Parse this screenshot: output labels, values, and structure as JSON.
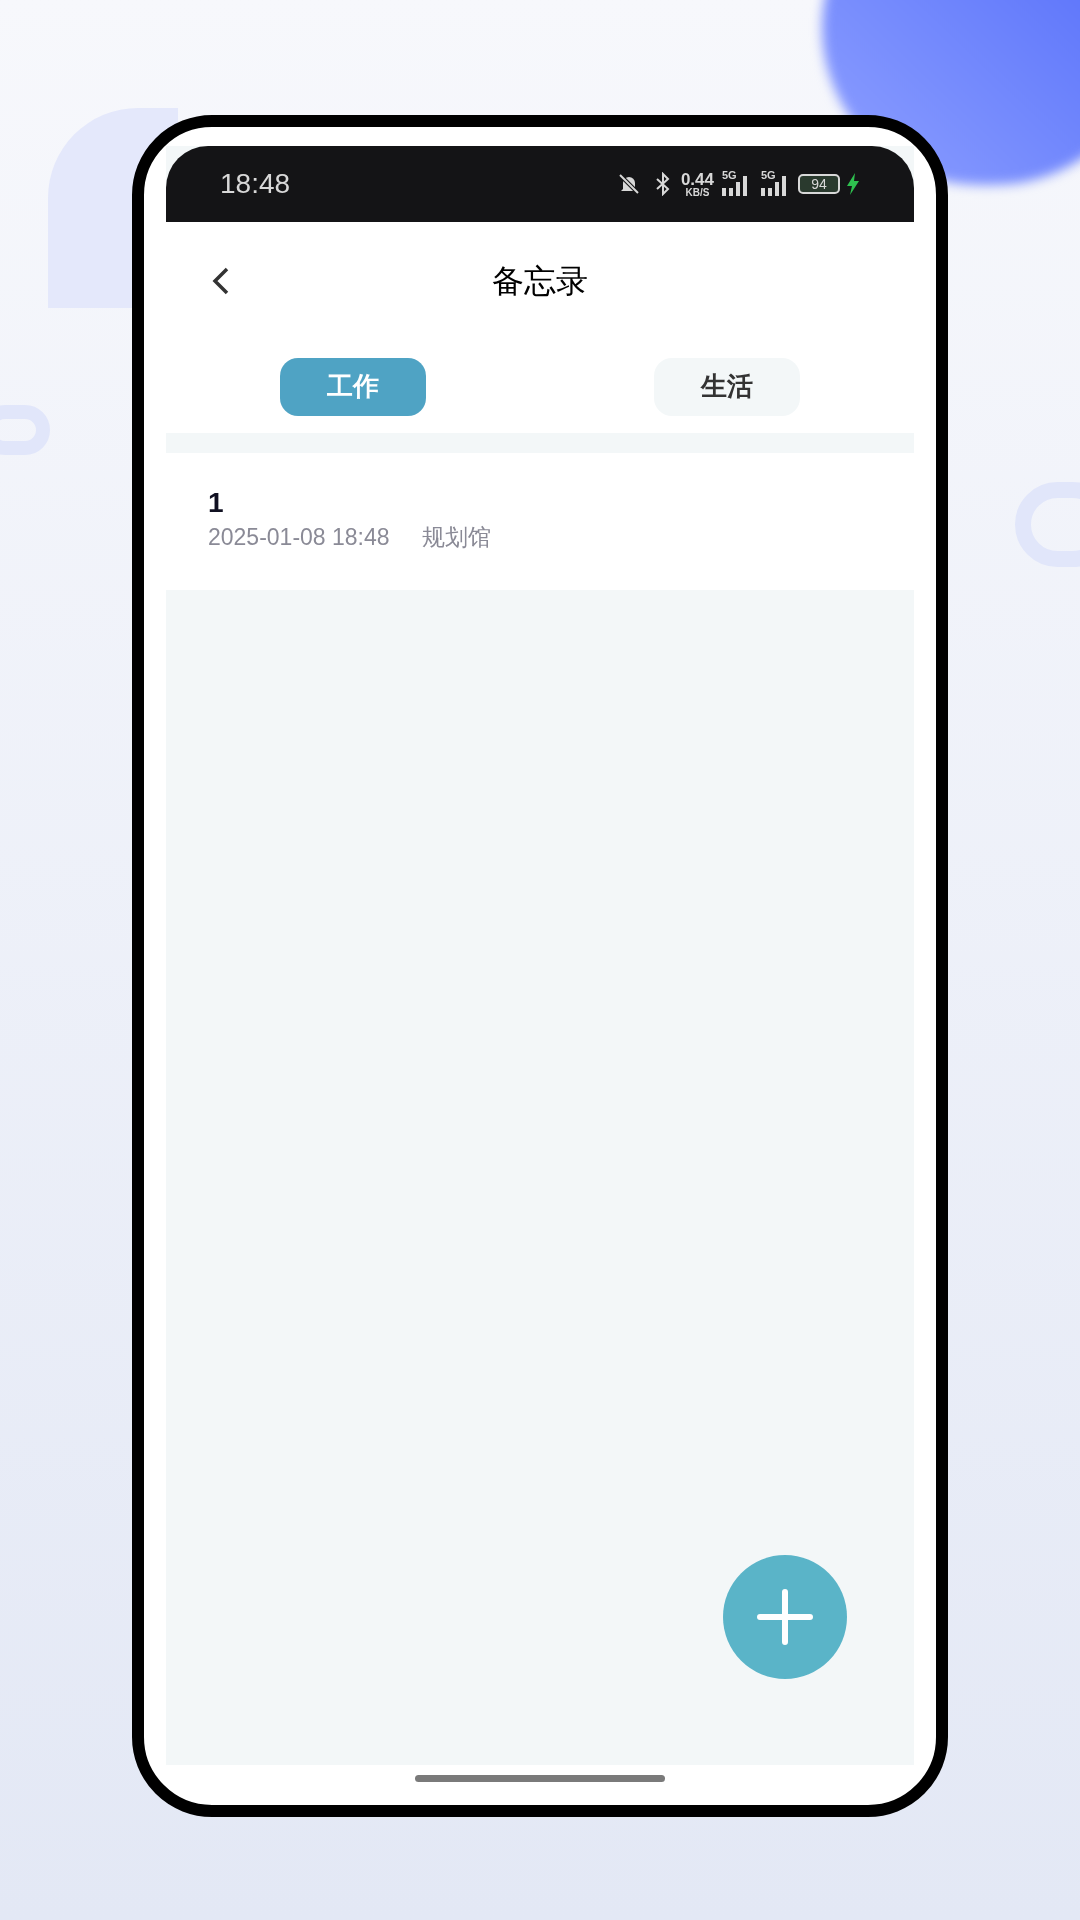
{
  "status_bar": {
    "time": "18:48",
    "net_speed": "0.44",
    "net_speed_unit": "KB/S",
    "signals": [
      {
        "label": "5G"
      },
      {
        "label": "5G"
      }
    ],
    "battery": "94",
    "charging": true
  },
  "header": {
    "title": "备忘录"
  },
  "tabs": [
    {
      "label": "工作",
      "selected": true
    },
    {
      "label": "生活",
      "selected": false
    }
  ],
  "notes": [
    {
      "title": "1",
      "date": "2025-01-08 18:48",
      "place": "规划馆"
    }
  ]
}
